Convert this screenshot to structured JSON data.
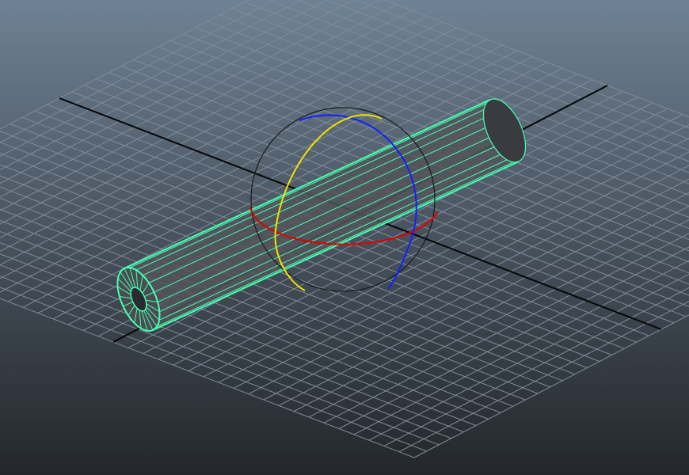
{
  "viewport": {
    "view": "perspective",
    "background": {
      "top": "#6f8295",
      "mid": "#48525d",
      "bottom": "#23272b"
    }
  },
  "grid": {
    "divisions": 20,
    "line_color": "#7f8c99",
    "axis_color": "#050505"
  },
  "selected_object": {
    "type": "pipe",
    "wire_color": "#45ffb0",
    "axial_segments": 20
  },
  "manipulator": {
    "type": "rotate",
    "ring_colors": {
      "x": "#e00000",
      "y": "#f0e000",
      "z": "#1020ff",
      "view": "#1a1a1a"
    }
  }
}
